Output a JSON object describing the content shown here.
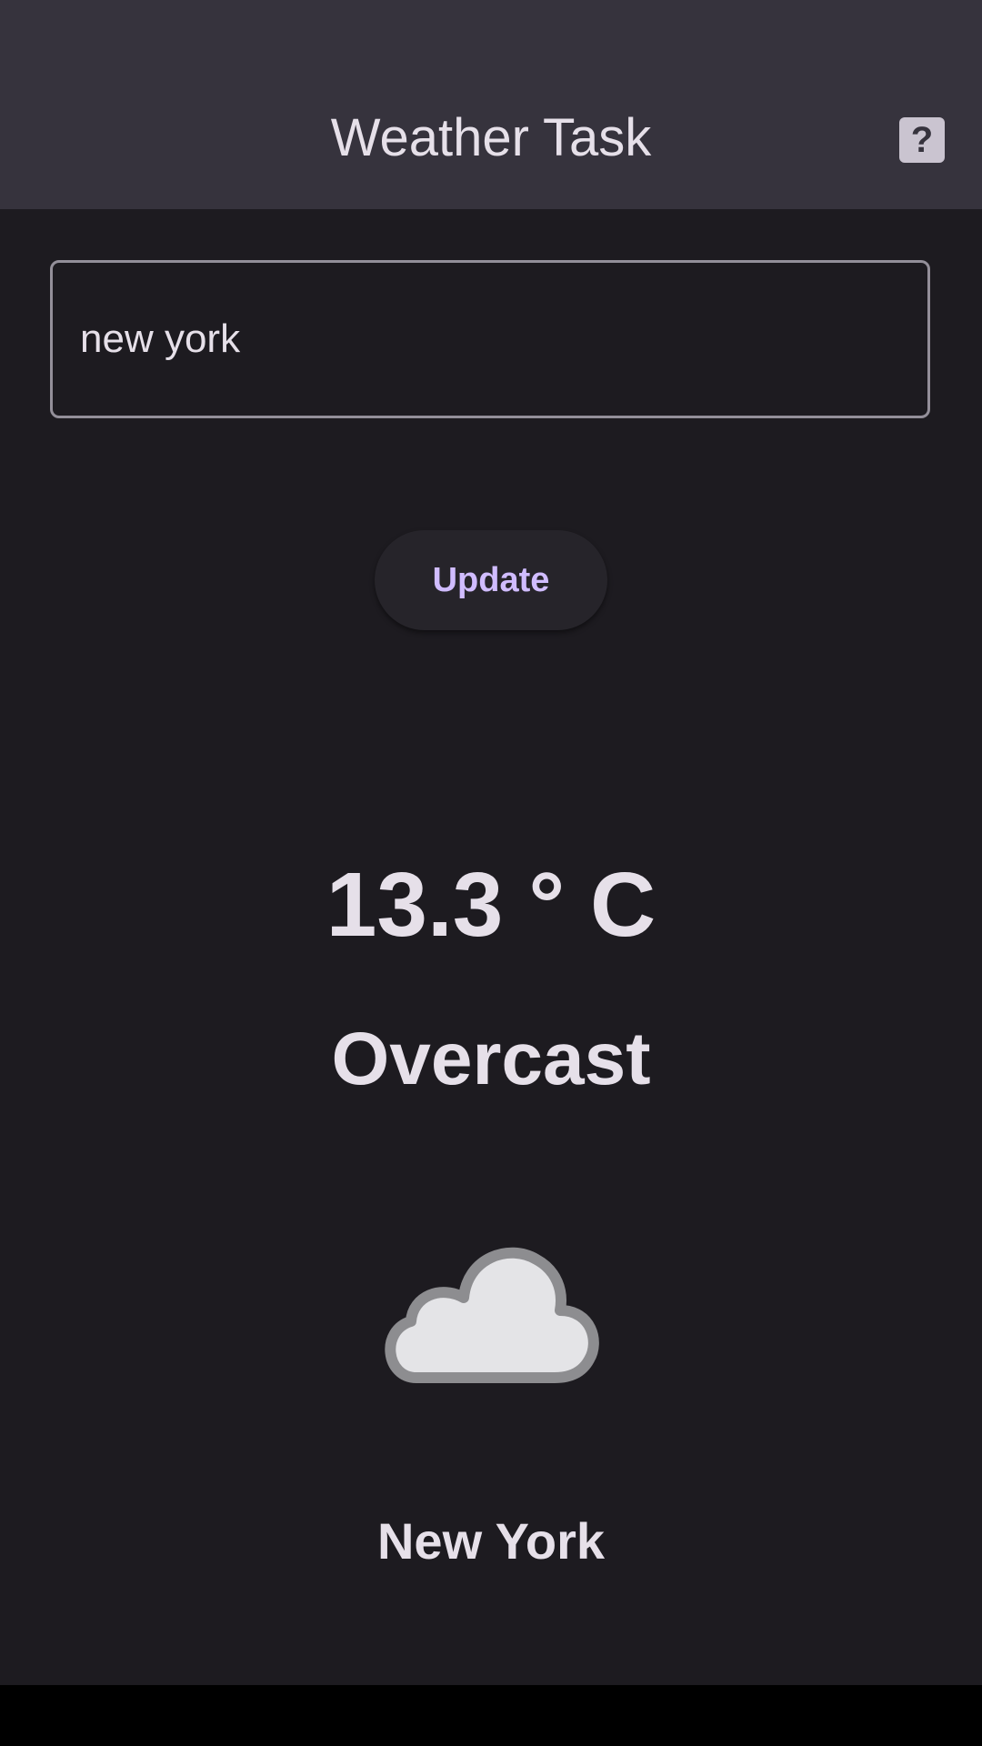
{
  "app_bar": {
    "title": "Weather Task",
    "help_icon": "question-icon",
    "help_label": "?"
  },
  "search": {
    "value": "new york",
    "placeholder": ""
  },
  "update_button": {
    "label": "Update"
  },
  "weather": {
    "temperature": "13.3 ° C",
    "condition": "Overcast",
    "icon": "cloud-icon",
    "city": "New York"
  },
  "colors": {
    "background": "#1d1b20",
    "app_bar": "#36333d",
    "text": "#e6e0e9",
    "accent": "#d0bcff",
    "outline": "#938f99"
  }
}
